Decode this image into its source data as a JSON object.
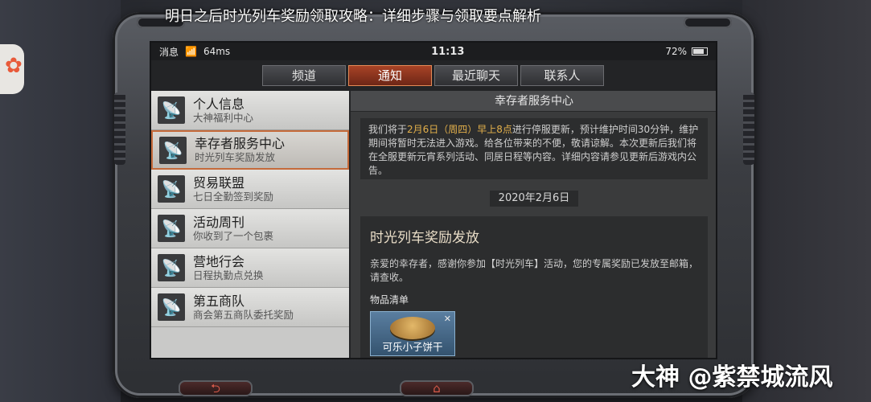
{
  "headline": "明日之后时光列车奖励领取攻略：详细步骤与领取要点解析",
  "watermark": "大神 @紫禁城流风",
  "status_bar": {
    "carrier": "消息",
    "speed": "64ms",
    "time": "11:13",
    "battery": "72%"
  },
  "tabs": [
    {
      "label": "频道",
      "active": false
    },
    {
      "label": "通知",
      "active": true
    },
    {
      "label": "最近聊天",
      "active": false
    },
    {
      "label": "联系人",
      "active": false
    }
  ],
  "sidebar": {
    "items": [
      {
        "title": "个人信息",
        "sub": "大神福利中心"
      },
      {
        "title": "幸存者服务中心",
        "sub": "时光列车奖励发放"
      },
      {
        "title": "贸易联盟",
        "sub": "七日全勤签到奖励"
      },
      {
        "title": "活动周刊",
        "sub": "你收到了一个包裹"
      },
      {
        "title": "营地行会",
        "sub": "日程执勤点兑换"
      },
      {
        "title": "第五商队",
        "sub": "商会第五商队委托奖励"
      }
    ]
  },
  "content": {
    "header": "幸存者服务中心",
    "msg1": {
      "line1_prefix": "我们将于",
      "line1_highlight": "2月6日（周四）早上8点",
      "line1_suffix": "进行停服更新，预计维护时间30分",
      "rest": "钟，维护期间将暂时无法进入游戏。给各位带来的不便，敬请谅解。本次更新后我们将在全服更新元宵系列活动、同居日程等内容。详细内容请参见更新后游戏内公告。"
    },
    "date": "2020年2月6日",
    "msg2": {
      "title": "时光列车奖励发放",
      "body": "亲爱的幸存者，感谢你参加【时光列车】活动，您的专属奖励已发放至邮箱，请查收。",
      "list_label": "物品清单",
      "item_name": "可乐小子饼干"
    }
  },
  "buttons": {
    "back": "⮌",
    "home": "⌂"
  }
}
